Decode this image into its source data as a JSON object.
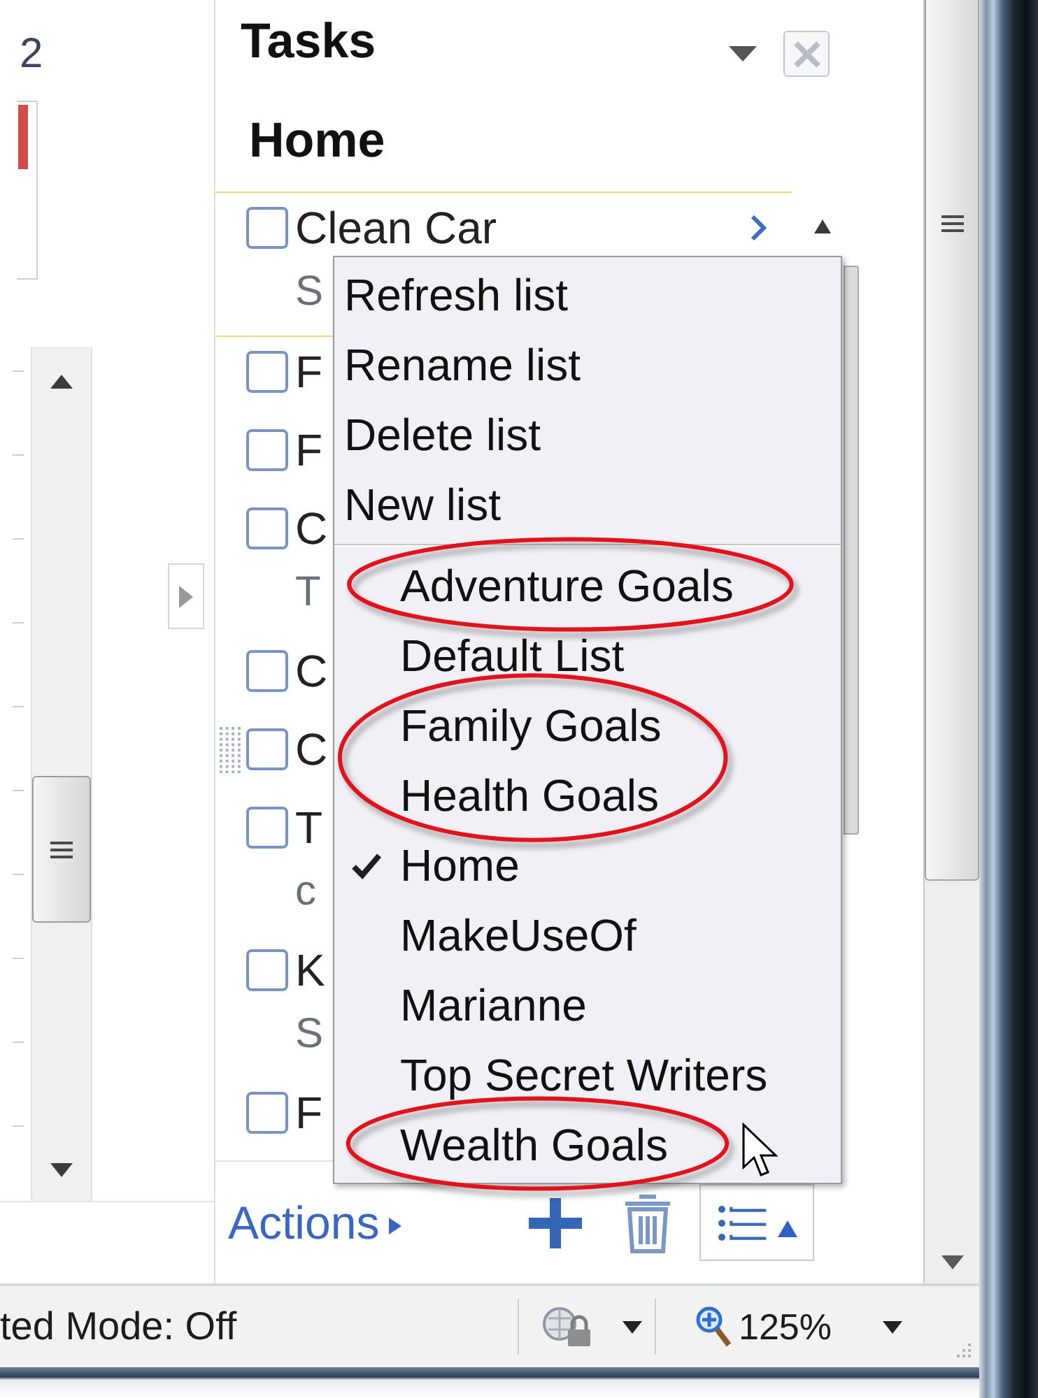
{
  "page": {
    "digit": "2"
  },
  "tasks_panel": {
    "title": "Tasks",
    "list_title": "Home"
  },
  "tasks": [
    {
      "title": "Clean Car",
      "note": "S",
      "checked": false,
      "selected": true,
      "hovered": false
    },
    {
      "title": "F",
      "checked": false,
      "selected": false,
      "hovered": false
    },
    {
      "title": "F",
      "checked": false,
      "selected": false,
      "hovered": false
    },
    {
      "title": "C",
      "note": "T",
      "checked": false,
      "selected": false,
      "hovered": false
    },
    {
      "title": "C",
      "checked": false,
      "selected": false,
      "hovered": false
    },
    {
      "title": "C",
      "checked": false,
      "selected": false,
      "hovered": true
    },
    {
      "title": "T",
      "note": "c",
      "checked": false,
      "selected": false,
      "hovered": false
    },
    {
      "title": "K",
      "note": "S",
      "checked": false,
      "selected": false,
      "hovered": false
    },
    {
      "title": "F",
      "checked": false,
      "selected": false,
      "hovered": false
    }
  ],
  "list_menu": {
    "actions": [
      "Refresh list",
      "Rename list",
      "Delete list",
      "New list"
    ],
    "lists": [
      {
        "name": "Adventure Goals",
        "selected": false,
        "highlighted": true
      },
      {
        "name": "Default List",
        "selected": false,
        "highlighted": false
      },
      {
        "name": "Family Goals",
        "selected": false,
        "highlighted": true
      },
      {
        "name": "Health Goals",
        "selected": false,
        "highlighted": true
      },
      {
        "name": "Home",
        "selected": true,
        "highlighted": false
      },
      {
        "name": "MakeUseOf",
        "selected": false,
        "highlighted": false
      },
      {
        "name": "Marianne",
        "selected": false,
        "highlighted": false
      },
      {
        "name": "Top Secret Writers",
        "selected": false,
        "highlighted": false
      },
      {
        "name": "Wealth Goals",
        "selected": false,
        "highlighted": true
      }
    ]
  },
  "footer": {
    "actions_link": "Actions"
  },
  "status_bar": {
    "mode_text": "ted Mode: Off",
    "zoom": "125%"
  }
}
